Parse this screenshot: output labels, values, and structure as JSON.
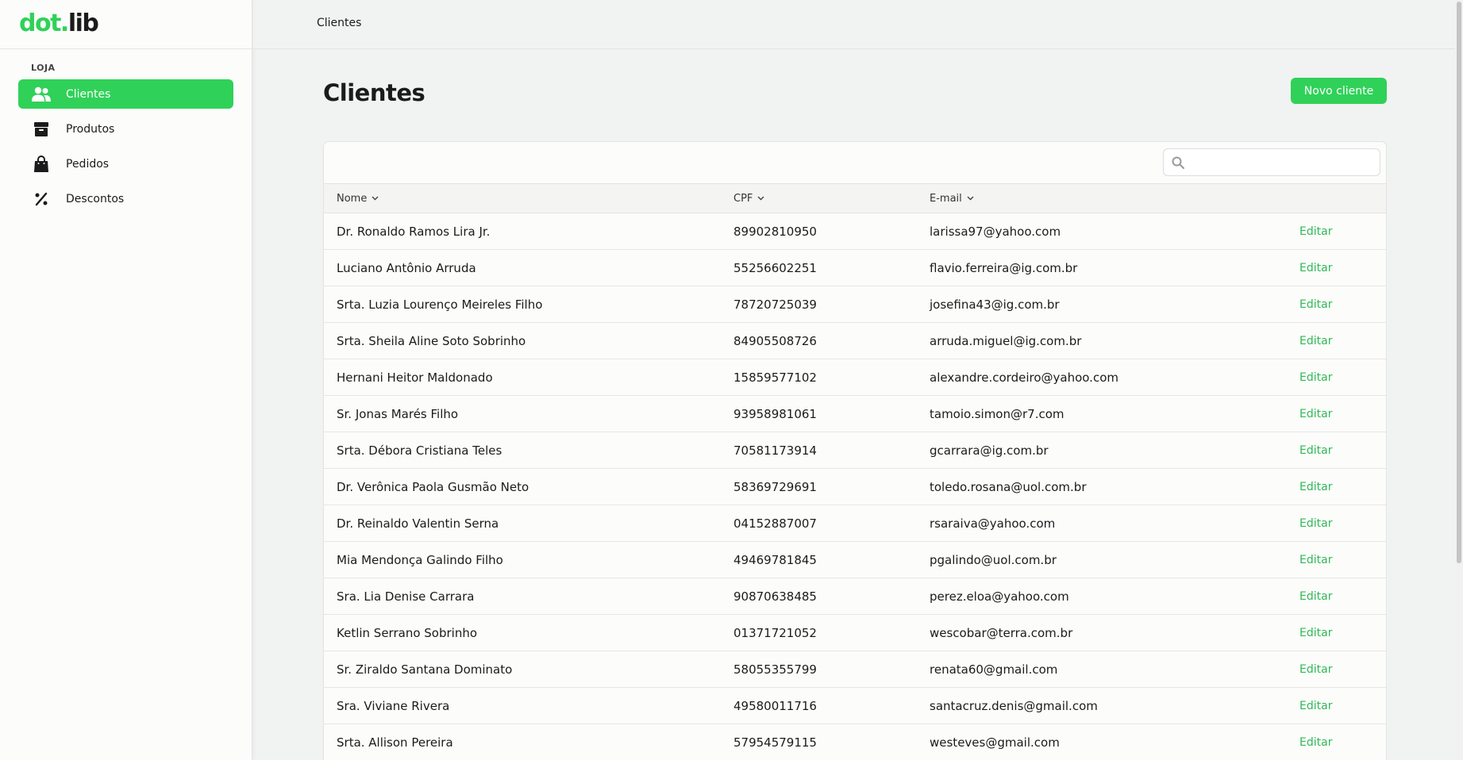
{
  "app": {
    "logo_part1": "dot.",
    "logo_part2": "lib"
  },
  "sidebar": {
    "section": "LOJA",
    "items": [
      {
        "label": "Clientes",
        "icon": "users-icon",
        "active": true
      },
      {
        "label": "Produtos",
        "icon": "box-icon",
        "active": false
      },
      {
        "label": "Pedidos",
        "icon": "shopping-bag-icon",
        "active": false
      },
      {
        "label": "Descontos",
        "icon": "percent-icon",
        "active": false
      }
    ]
  },
  "header": {
    "breadcrumb": "Clientes"
  },
  "main": {
    "title": "Clientes",
    "new_button": "Novo cliente",
    "search": {
      "value": "",
      "placeholder": ""
    }
  },
  "table": {
    "columns": [
      "Nome",
      "CPF",
      "E-mail"
    ],
    "action_label": "Editar",
    "rows": [
      {
        "name": "Dr. Ronaldo Ramos Lira Jr.",
        "cpf": "89902810950",
        "email": "larissa97@yahoo.com"
      },
      {
        "name": "Luciano Antônio Arruda",
        "cpf": "55256602251",
        "email": "flavio.ferreira@ig.com.br"
      },
      {
        "name": "Srta. Luzia Lourenço Meireles Filho",
        "cpf": "78720725039",
        "email": "josefina43@ig.com.br"
      },
      {
        "name": "Srta. Sheila Aline Soto Sobrinho",
        "cpf": "84905508726",
        "email": "arruda.miguel@ig.com.br"
      },
      {
        "name": "Hernani Heitor Maldonado",
        "cpf": "15859577102",
        "email": "alexandre.cordeiro@yahoo.com"
      },
      {
        "name": "Sr. Jonas Marés Filho",
        "cpf": "93958981061",
        "email": "tamoio.simon@r7.com"
      },
      {
        "name": "Srta. Débora Cristiana Teles",
        "cpf": "70581173914",
        "email": "gcarrara@ig.com.br"
      },
      {
        "name": "Dr. Verônica Paola Gusmão Neto",
        "cpf": "58369729691",
        "email": "toledo.rosana@uol.com.br"
      },
      {
        "name": "Dr. Reinaldo Valentin Serna",
        "cpf": "04152887007",
        "email": "rsaraiva@yahoo.com"
      },
      {
        "name": "Mia Mendonça Galindo Filho",
        "cpf": "49469781845",
        "email": "pgalindo@uol.com.br"
      },
      {
        "name": "Sra. Lia Denise Carrara",
        "cpf": "90870638485",
        "email": "perez.eloa@yahoo.com"
      },
      {
        "name": "Ketlin Serrano Sobrinho",
        "cpf": "01371721052",
        "email": "wescobar@terra.com.br"
      },
      {
        "name": "Sr. Ziraldo Santana Dominato",
        "cpf": "58055355799",
        "email": "renata60@gmail.com"
      },
      {
        "name": "Sra. Viviane Rivera",
        "cpf": "49580011716",
        "email": "santacruz.denis@gmail.com"
      },
      {
        "name": "Srta. Allison Pereira",
        "cpf": "57954579115",
        "email": "westeves@gmail.com"
      }
    ]
  },
  "colors": {
    "accent": "#30d158",
    "link": "#30b957",
    "background": "#f1f2f2",
    "sidebar": "#fcfcfb"
  }
}
